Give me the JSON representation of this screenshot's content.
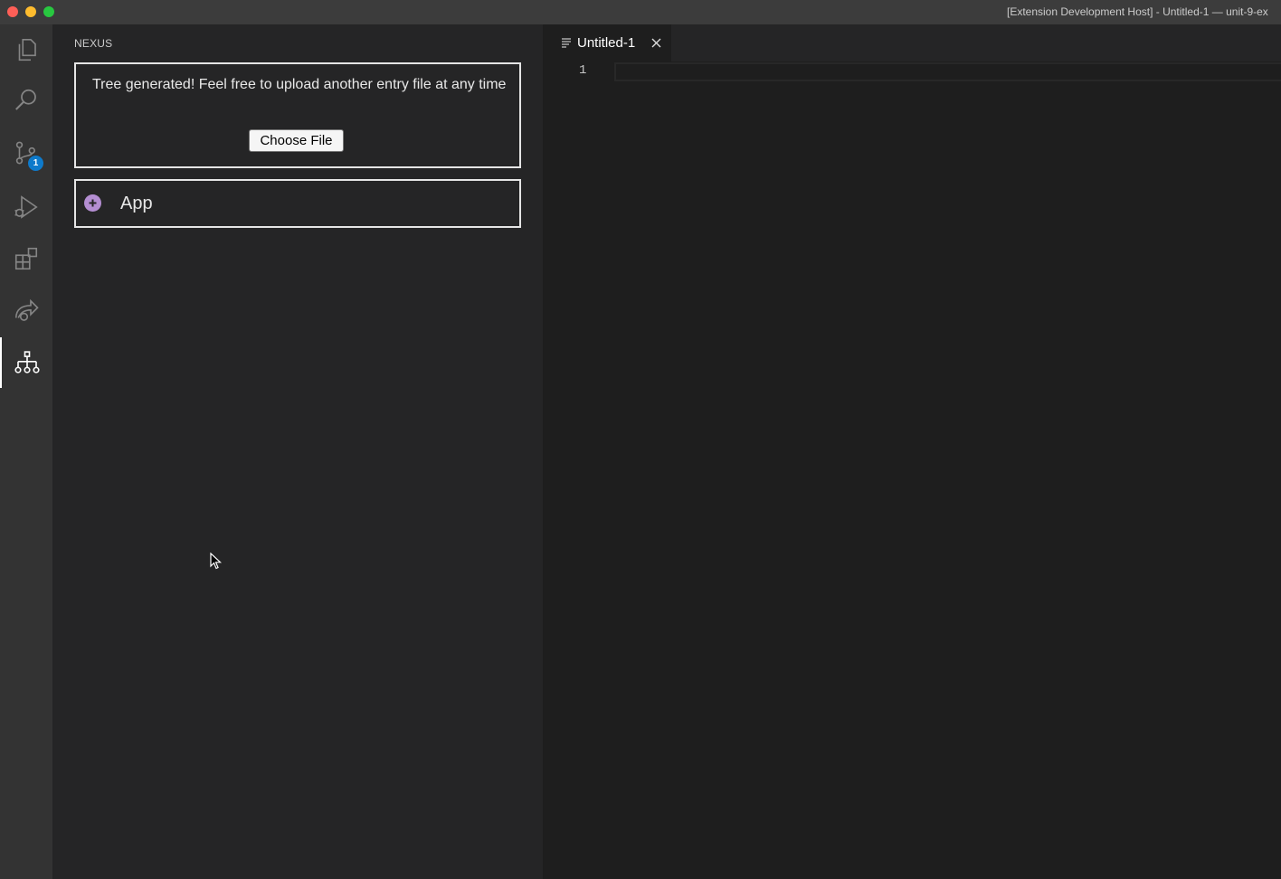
{
  "titlebar": {
    "title": "[Extension Development Host] - Untitled-1 — unit-9-ex"
  },
  "activitybar": {
    "items": [
      {
        "name": "explorer",
        "icon": "files-icon"
      },
      {
        "name": "search",
        "icon": "search-icon"
      },
      {
        "name": "source-control",
        "icon": "source-control-icon",
        "badge": "1"
      },
      {
        "name": "run-and-debug",
        "icon": "run-debug-icon"
      },
      {
        "name": "extensions",
        "icon": "extensions-icon"
      },
      {
        "name": "remote",
        "icon": "remote-share-icon"
      },
      {
        "name": "nexus",
        "icon": "tree-hierarchy-icon",
        "active": true
      }
    ],
    "colors": {
      "background": "#333333",
      "badge": "#0e7acb"
    }
  },
  "sidebar": {
    "title": "NEXUS",
    "upload": {
      "message": "Tree generated! Feel free to upload another entry file at any time",
      "button_label": "Choose File"
    },
    "tree": {
      "root_label": "App",
      "toggle_icon": "plus-circle-icon",
      "toggle_color": "#b48ed2"
    }
  },
  "editor": {
    "tab_label": "Untitled-1",
    "tab_icon": "lines-file-icon",
    "close_icon": "close-icon",
    "line_numbers": [
      "1"
    ]
  }
}
